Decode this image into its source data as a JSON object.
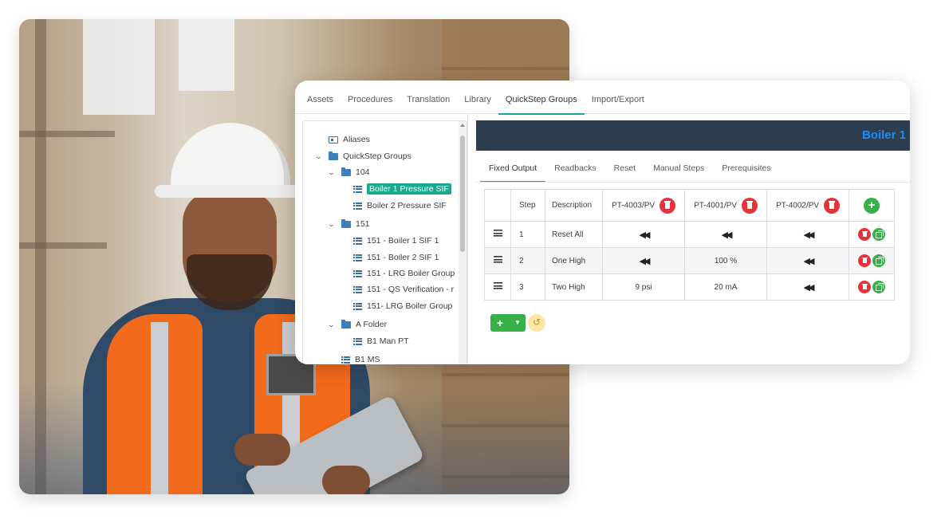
{
  "app": {
    "nav_tabs": [
      "Assets",
      "Procedures",
      "Translation",
      "Library",
      "QuickStep Groups",
      "Import/Export"
    ],
    "active_nav_tab": "QuickStep Groups",
    "tree": [
      {
        "label": "Aliases",
        "icon": "alias-icon"
      },
      {
        "label": "QuickStep Groups",
        "icon": "folder-icon"
      },
      {
        "label": "104",
        "icon": "folder-icon"
      },
      {
        "label": "Boiler 1 Pressure SIF",
        "icon": "list-icon",
        "selected": true
      },
      {
        "label": "Boiler 2 Pressure SIF",
        "icon": "list-icon"
      },
      {
        "label": "151",
        "icon": "folder-icon"
      },
      {
        "label": "151 - Boiler 1 SIF 1",
        "icon": "list-icon"
      },
      {
        "label": "151 - Boiler 2 SIF 1",
        "icon": "list-icon"
      },
      {
        "label": "151 - LRG Boiler Group",
        "icon": "list-icon"
      },
      {
        "label": "151 - QS Verification - r",
        "icon": "list-icon"
      },
      {
        "label": "151- LRG Boiler Group",
        "icon": "list-icon"
      },
      {
        "label": "A Folder",
        "icon": "folder-icon"
      },
      {
        "label": "B1 Man PT",
        "icon": "list-icon"
      },
      {
        "label": "B1 MS",
        "icon": "list-icon"
      }
    ],
    "header_title": "Boiler 1",
    "sub_tabs": [
      "Fixed Output",
      "Readbacks",
      "Reset",
      "Manual Steps",
      "Prerequisites"
    ],
    "active_sub_tab": "Fixed Output",
    "table": {
      "headers": {
        "step": "Step",
        "description": "Description",
        "pt1": "PT-4003/PV",
        "pt2": "PT-4001/PV",
        "pt3": "PT-4002/PV"
      },
      "rows": [
        {
          "step": "1",
          "description": "Reset All",
          "pt1": "",
          "pt2": "",
          "pt3": ""
        },
        {
          "step": "2",
          "description": "One High",
          "pt1": "",
          "pt2": "100 %",
          "pt3": ""
        },
        {
          "step": "3",
          "description": "Two High",
          "pt1": "9 psi",
          "pt2": "20 mA",
          "pt3": ""
        }
      ]
    },
    "colors": {
      "accent": "#20a88f",
      "header_bg": "#2c3e50",
      "title": "#1e8cf0",
      "danger": "#e8323a",
      "success": "#38b048"
    }
  }
}
